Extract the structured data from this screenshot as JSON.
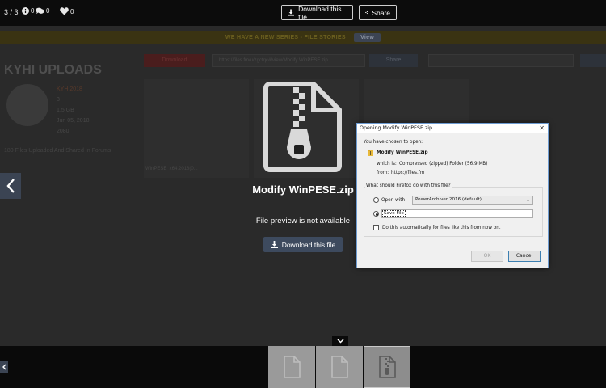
{
  "topbar": {
    "counter": "3 / 3",
    "info_count": "0",
    "comments_count": "0",
    "likes_count": "0",
    "download_label": "Download this file",
    "share_label": "Share"
  },
  "background_page": {
    "banner_text": "WE HAVE A NEW SERIES - FILE STORIES",
    "banner_view": "View",
    "title": "KYHI UPLOADS",
    "username": "KYHI2018",
    "file_count": "3",
    "size": "1.5 GB",
    "date": "Jun 05, 2018",
    "views": "2080",
    "description": "180 Files Uploaded And Shared In Forums",
    "download_btn": "Download",
    "url": "https://files.fm/u/zgctqc#/view/Modify WinPESE.zip",
    "share_btn": "Share",
    "file_label": "WinPESE_x64.2018(0..."
  },
  "preview": {
    "file_name": "Modify WinPESE.zip",
    "no_preview_text": "File preview is not available",
    "download_label": "Download this file"
  },
  "dialog": {
    "title": "Opening Modify WinPESE.zip",
    "chosen_text": "You have chosen to open:",
    "file_name": "Modify WinPESE.zip",
    "which_is_label": "which is:",
    "which_is_value": "Compressed (zipped) Folder (56.9 MB)",
    "from_label": "from:",
    "from_value": "https://files.fm",
    "question": "What should Firefox do with this file?",
    "open_with_label": "Open with",
    "open_with_app": "PowerArchiver 2016 (default)",
    "save_file_label": "Save File",
    "auto_label": "Do this automatically for files like this from now on.",
    "ok_label": "OK",
    "cancel_label": "Cancel"
  }
}
